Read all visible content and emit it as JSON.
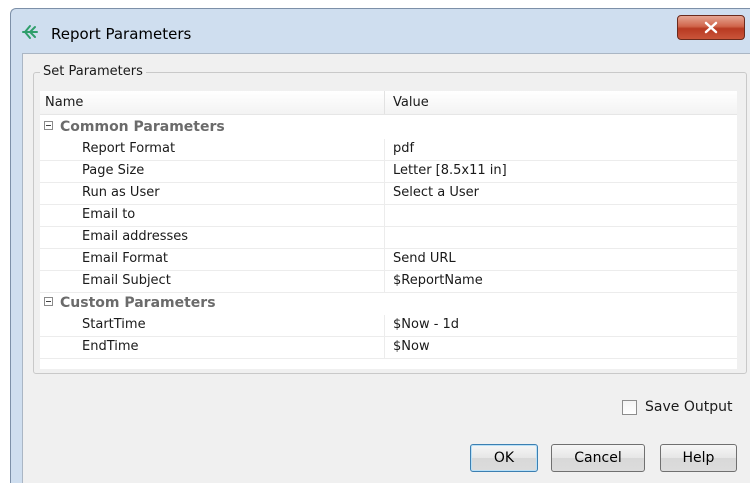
{
  "window": {
    "title": "Report Parameters",
    "icon": "report-parameters-icon",
    "close_icon": "close-icon"
  },
  "group": {
    "label": "Set Parameters"
  },
  "grid": {
    "columns": [
      "Name",
      "Value"
    ],
    "categories": [
      {
        "label": "Common Parameters",
        "rows": [
          {
            "name": "Report Format",
            "value": "pdf"
          },
          {
            "name": "Page Size",
            "value": "Letter [8.5x11 in]"
          },
          {
            "name": "Run as User",
            "value": "Select a User"
          },
          {
            "name": "Email to",
            "value": ""
          },
          {
            "name": "Email addresses",
            "value": ""
          },
          {
            "name": "Email Format",
            "value": "Send URL"
          },
          {
            "name": "Email Subject",
            "value": "$ReportName"
          }
        ]
      },
      {
        "label": "Custom Parameters",
        "rows": [
          {
            "name": "StartTime",
            "value": "$Now - 1d"
          },
          {
            "name": "EndTime",
            "value": "$Now"
          }
        ]
      }
    ]
  },
  "save_output": {
    "label": "Save Output",
    "checked": false
  },
  "buttons": {
    "ok": "OK",
    "cancel": "Cancel",
    "help": "Help"
  },
  "colors": {
    "titlebar": "#cfdeef",
    "close_button": "#c9553a",
    "client": "#f0f0f0",
    "category_text": "#6b6b6b"
  }
}
